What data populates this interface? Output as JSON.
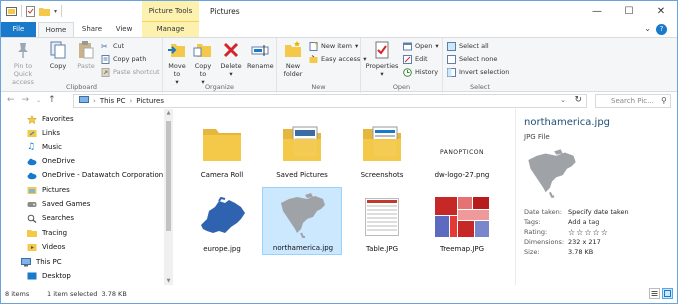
{
  "window": {
    "title": "Pictures",
    "contextual_tab_group": "Picture Tools",
    "controls": {
      "minimize": "—",
      "maximize": "☐",
      "close": "✕"
    }
  },
  "ribbon_tabs": [
    "File",
    "Home",
    "Share",
    "View",
    "Manage"
  ],
  "ribbon": {
    "clipboard": {
      "label": "Clipboard",
      "pin": "Pin to Quick access",
      "copy": "Copy",
      "paste": "Paste",
      "cut": "Cut",
      "copy_path": "Copy path",
      "paste_shortcut": "Paste shortcut"
    },
    "organize": {
      "label": "Organize",
      "move_to": "Move to",
      "copy_to": "Copy to",
      "delete": "Delete",
      "rename": "Rename"
    },
    "new": {
      "label": "New",
      "new_folder": "New folder",
      "new_item": "New item",
      "easy_access": "Easy access"
    },
    "open": {
      "label": "Open",
      "properties": "Properties",
      "open": "Open",
      "edit": "Edit",
      "history": "History"
    },
    "select": {
      "label": "Select",
      "select_all": "Select all",
      "select_none": "Select none",
      "invert_selection": "Invert selection"
    }
  },
  "address": {
    "crumbs": [
      "This PC",
      "Pictures"
    ],
    "search_placeholder": "Search Pic..."
  },
  "nav_pane": [
    {
      "label": "Favorites",
      "icon": "star-icon"
    },
    {
      "label": "Links",
      "icon": "link-icon"
    },
    {
      "label": "Music",
      "icon": "music-icon"
    },
    {
      "label": "OneDrive",
      "icon": "cloud-icon"
    },
    {
      "label": "OneDrive - Datawatch Corporation",
      "icon": "cloud-icon"
    },
    {
      "label": "Pictures",
      "icon": "pictures-folder-icon"
    },
    {
      "label": "Saved Games",
      "icon": "games-icon"
    },
    {
      "label": "Searches",
      "icon": "search-icon"
    },
    {
      "label": "Tracing",
      "icon": "folder-icon"
    },
    {
      "label": "Videos",
      "icon": "video-icon"
    },
    {
      "label": "This PC",
      "icon": "computer-icon"
    },
    {
      "label": "Desktop",
      "icon": "desktop-icon"
    }
  ],
  "files": [
    {
      "label": "Camera Roll",
      "kind": "folder"
    },
    {
      "label": "Saved Pictures",
      "kind": "folder-with-content"
    },
    {
      "label": "Screenshots",
      "kind": "folder-with-content"
    },
    {
      "label": "dw-logo-27.png",
      "kind": "logo",
      "logo_text": "PANOPTICON"
    },
    {
      "label": "europe.jpg",
      "kind": "europe-map"
    },
    {
      "label": "northamerica.jpg",
      "kind": "na-map",
      "selected": true
    },
    {
      "label": "Table.JPG",
      "kind": "table"
    },
    {
      "label": "Treemap.JPG",
      "kind": "treemap"
    }
  ],
  "preview": {
    "name": "northamerica.jpg",
    "type": "JPG File",
    "props": [
      {
        "k": "Date taken:",
        "v": "Specify date taken"
      },
      {
        "k": "Tags:",
        "v": "Add a tag"
      },
      {
        "k": "Rating:",
        "v": "☆☆☆☆☆"
      },
      {
        "k": "Dimensions:",
        "v": "232 x 217"
      },
      {
        "k": "Size:",
        "v": "3.78 KB"
      }
    ]
  },
  "status": {
    "items": "8 items",
    "selection": "1 item selected  3.78 KB"
  },
  "colors": {
    "accent": "#1979ca",
    "selection": "#cce8ff",
    "context_tab": "#fdf1b0",
    "folder": "#f4c94a"
  }
}
